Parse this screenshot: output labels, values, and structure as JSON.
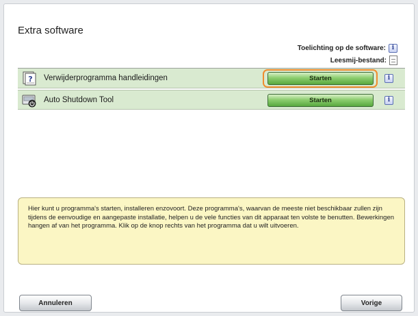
{
  "page": {
    "title": "Extra software"
  },
  "legend": {
    "info_label": "Toelichting op de software:",
    "readme_label": "Leesmij-bestand:"
  },
  "programs": [
    {
      "name": "Verwijderprogramma handleidingen",
      "button": "Starten",
      "icon": "uninstall-manual-icon",
      "focused": true
    },
    {
      "name": "Auto Shutdown Tool",
      "button": "Starten",
      "icon": "shutdown-tool-icon",
      "focused": false
    }
  ],
  "info_glyph": "i",
  "help_text": "Hier kunt u programma's starten, installeren enzovoort. Deze programma's, waarvan de meeste niet beschikbaar zullen zijn tijdens de eenvoudige en aangepaste installatie, helpen u de vele functies van dit apparaat ten volste te benutten. Bewerkingen hangen af van het programma. Klik op de knop rechts van het programma dat u wilt uitvoeren.",
  "footer": {
    "cancel_label": "Annuleren",
    "back_label": "Vorige"
  },
  "colors": {
    "row_bg": "#d9ead0",
    "start_button": "#8ccd6e",
    "focus_ring": "#f08c2e",
    "help_bg": "#fbf6c4"
  }
}
